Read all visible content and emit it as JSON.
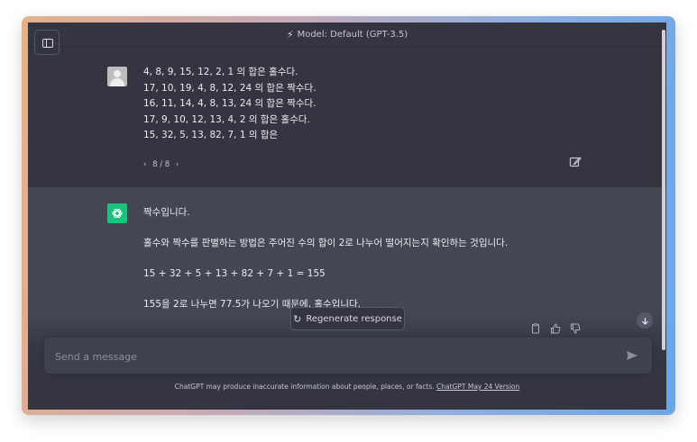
{
  "header": {
    "model_label": "Model: Default (GPT-3.5)"
  },
  "user_message": {
    "lines": [
      "4, 8, 9, 15, 12, 2, 1 의 합은 홀수다.",
      "17,  10, 19, 4, 8, 12, 24 의 합은 짝수다.",
      "16,  11, 14, 4, 8, 13, 24 의 합은 짝수다.",
      "17,  9, 10, 12, 13, 4, 2 의 합은 홀수다.",
      "15, 32, 5, 13, 82, 7, 1 의 합은"
    ],
    "pager": {
      "prev": "‹",
      "label": "8 / 8",
      "next": "›"
    }
  },
  "assistant_message": {
    "paragraphs": [
      "짝수입니다.",
      "홀수와 짝수를 판별하는 방법은 주어진 수의 합이 2로 나누어 떨어지는지 확인하는 것입니다.",
      "15 + 32 + 5 + 13 + 82 + 7 + 1 = 155",
      "155을 2로 나누면 77.5가 나오기 때문에, 홀수입니다."
    ]
  },
  "regenerate": {
    "label": "Regenerate response"
  },
  "composer": {
    "placeholder": "Send a message"
  },
  "footer": {
    "text": "ChatGPT may produce inaccurate information about people, places, or facts. ",
    "link": "ChatGPT May 24 Version"
  }
}
